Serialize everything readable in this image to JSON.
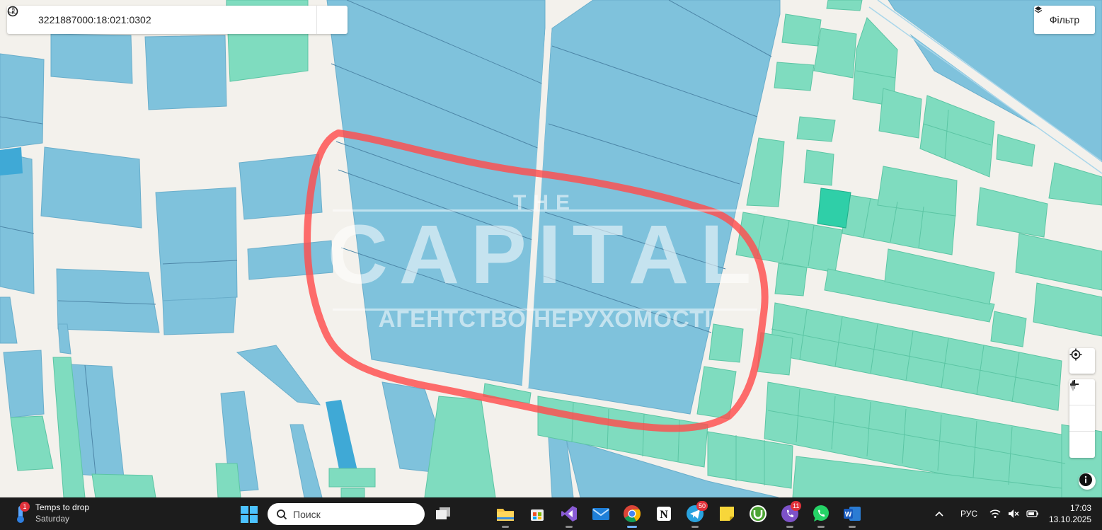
{
  "search": {
    "value": "3221887000:18:021:0302",
    "placeholder": ""
  },
  "filter_label": "Фільтр",
  "watermark": {
    "top": "THE",
    "main": "CAPITAL",
    "sub": "АГЕНТСТВО НЕРУХОМОСТІ"
  },
  "colors": {
    "parcel_blue": "#7fc2dc",
    "parcel_green": "#7fdcbf",
    "parcel_selected": "#2fcfa8",
    "outline_annotation": "#ff4d4d",
    "road": "#f3f1ec"
  },
  "taskbar": {
    "weather": {
      "title": "Temps to drop",
      "subtitle": "Saturday",
      "badge": "1"
    },
    "search_label": "Поиск",
    "apps": [
      {
        "name": "file-explorer-icon"
      },
      {
        "name": "microsoft-store-icon"
      },
      {
        "name": "visual-studio-icon"
      },
      {
        "name": "mail-icon"
      },
      {
        "name": "chrome-icon"
      },
      {
        "name": "notion-icon"
      },
      {
        "name": "telegram-icon",
        "badge": "50"
      },
      {
        "name": "sticky-notes-icon"
      },
      {
        "name": "utorrent-icon"
      },
      {
        "name": "viber-icon",
        "badge": "11"
      },
      {
        "name": "whatsapp-icon"
      },
      {
        "name": "word-icon"
      }
    ],
    "language": "РУС",
    "time": "17:03",
    "date": "13.10.2025"
  }
}
